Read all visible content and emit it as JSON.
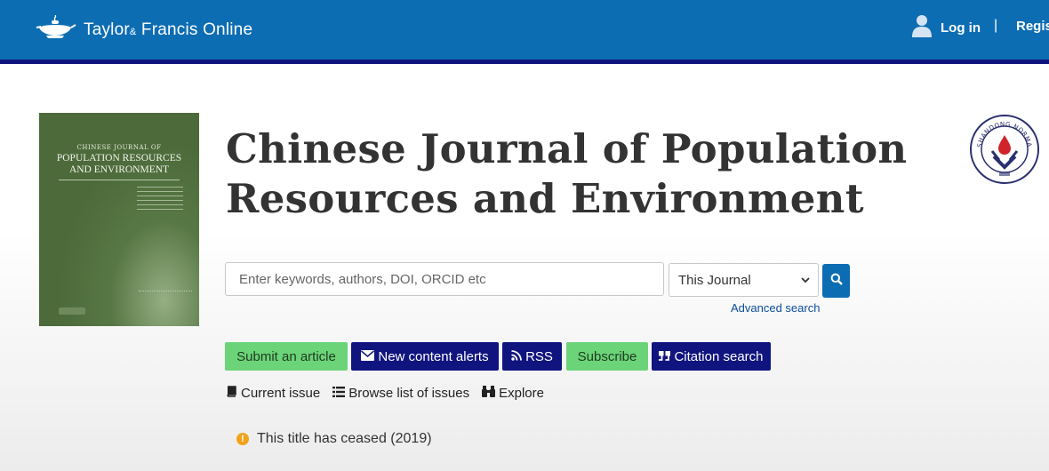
{
  "header": {
    "brand_main": "Taylor",
    "brand_amp": "&",
    "brand_rest": " Francis Online",
    "login_label": "Log in",
    "separator": "|",
    "register_label": "Register",
    "bg_color": "#0d6db3",
    "stripe_color": "#10147e"
  },
  "cover": {
    "line1": "CHINESE JOURNAL OF",
    "title_line1": "POPULATION RESOURCES",
    "title_line2": "AND ENVIRONMENT"
  },
  "journal": {
    "title_line1": "Chinese Journal of Population",
    "title_line2": "Resources and Environment"
  },
  "search": {
    "placeholder": "Enter keywords, authors, DOI, ORCID etc",
    "scope_selected": "This Journal",
    "button_icon": "search-icon",
    "advanced_link": "Advanced search"
  },
  "actions": [
    {
      "label": "Submit an article",
      "style": "green"
    },
    {
      "label": "New content alerts",
      "style": "navy",
      "icon": "envelope-icon"
    },
    {
      "label": "RSS",
      "style": "navy",
      "icon": "rss-icon"
    },
    {
      "label": "Subscribe",
      "style": "green"
    },
    {
      "label": "Citation search",
      "style": "navy",
      "icon": "quote-icon"
    }
  ],
  "links": [
    {
      "label": "Current issue",
      "icon": "book-icon"
    },
    {
      "label": "Browse list of issues",
      "icon": "list-icon"
    },
    {
      "label": "Explore",
      "icon": "binoculars-icon"
    }
  ],
  "notice": {
    "icon": "exclamation-icon",
    "text": "This title has ceased (2019)"
  },
  "colors": {
    "green_button": "#6cd478",
    "navy_button": "#10147e",
    "notice_icon": "#f0a21a"
  }
}
